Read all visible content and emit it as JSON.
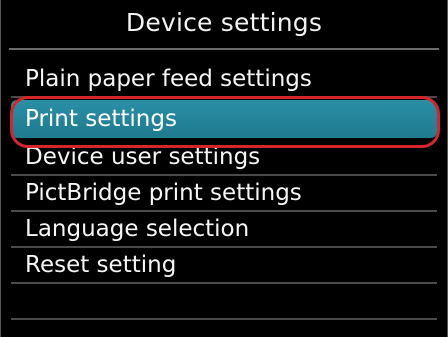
{
  "header": {
    "title": "Device settings"
  },
  "menu": {
    "items": [
      {
        "label": "Plain paper feed settings",
        "selected": false
      },
      {
        "label": "Print settings",
        "selected": true
      },
      {
        "label": "Device user settings",
        "selected": false
      },
      {
        "label": "PictBridge print settings",
        "selected": false
      },
      {
        "label": "Language selection",
        "selected": false
      },
      {
        "label": "Reset setting",
        "selected": false
      }
    ]
  },
  "colors": {
    "background": "#000000",
    "selection": "#2a8fa6",
    "highlight_ring": "#d4262b",
    "text": "#f5f5f5"
  }
}
